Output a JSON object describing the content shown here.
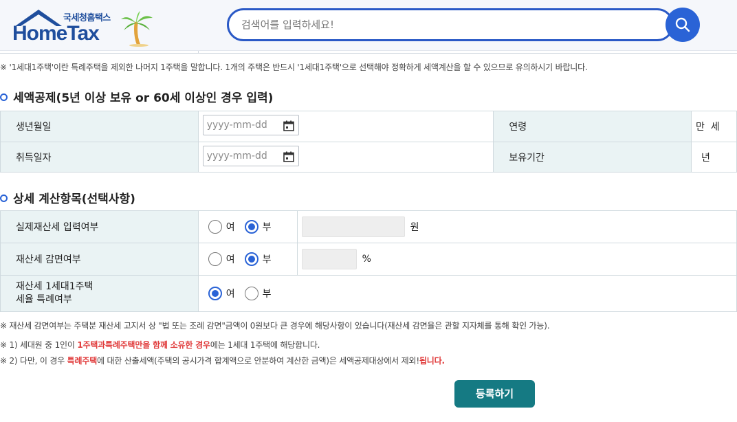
{
  "header": {
    "logo_kr": "국세청홈택스",
    "logo_en": "HomeTax",
    "search_placeholder": "검색어를 입력하세요!"
  },
  "notes": {
    "single_house": "※ '1세대1주택'이란 특례주택을 제외한 나머지 1주택을 말합니다. 1개의 주택은 반드시 '1세대1주택'으로 선택해야 정확하게 세액계산을 할 수 있으므로 유의하시기 바랍니다.",
    "reduction": "※ 재산세 감면여부는 주택분 재산세 고지서 상 \"법 또는 조례 감면\"금액이 0원보다 큰 경우에 해당사항이 있습니다(재산세 감면율은 관할 지자체를 통해 확인 가능).",
    "line1_a": "※ 1) 세대원 중 1인이 ",
    "line1_red": "1주택과특례주택만을 함께 소유한 경우",
    "line1_b": "에는 1세대 1주택에 해당합니다.",
    "line2_a": "※ 2) 다만, 이 경우 ",
    "line2_red": "특례주택",
    "line2_b": "에 대한 산출세액(주택의 공시가격 합계액으로 안분하여 계산한 금액)은 세액공제대상에서 제외",
    "line2_c": "!",
    "line2_red2": "됩니다."
  },
  "deduction": {
    "title": "세액공제(5년 이상 보유 or 60세 이상인 경우 입력)",
    "birth_label": "생년월일",
    "acquire_label": "취득일자",
    "date_placeholder": "yyyy-mm-dd",
    "age_label": "연령",
    "age_value": "만  세",
    "period_label": "보유기간",
    "period_value": "년"
  },
  "details": {
    "title": "상세 계산항목(선택사항)",
    "rows": [
      {
        "label": "실제재산세 입력여부",
        "yes": "여",
        "no": "부",
        "unit": "원"
      },
      {
        "label": "재산세 감면여부",
        "yes": "여",
        "no": "부",
        "unit": "%"
      },
      {
        "label1": "재산세 1세대1주택",
        "label2": "세율 특례여부",
        "yes": "여",
        "no": "부"
      }
    ]
  },
  "actions": {
    "register": "등록하기"
  },
  "colors": {
    "brand": "#1f4e9d",
    "search_border": "#2a59c6",
    "radio_selected": "#2a63d6",
    "register_button": "#157a83",
    "highlight_red": "#e03a3a"
  }
}
